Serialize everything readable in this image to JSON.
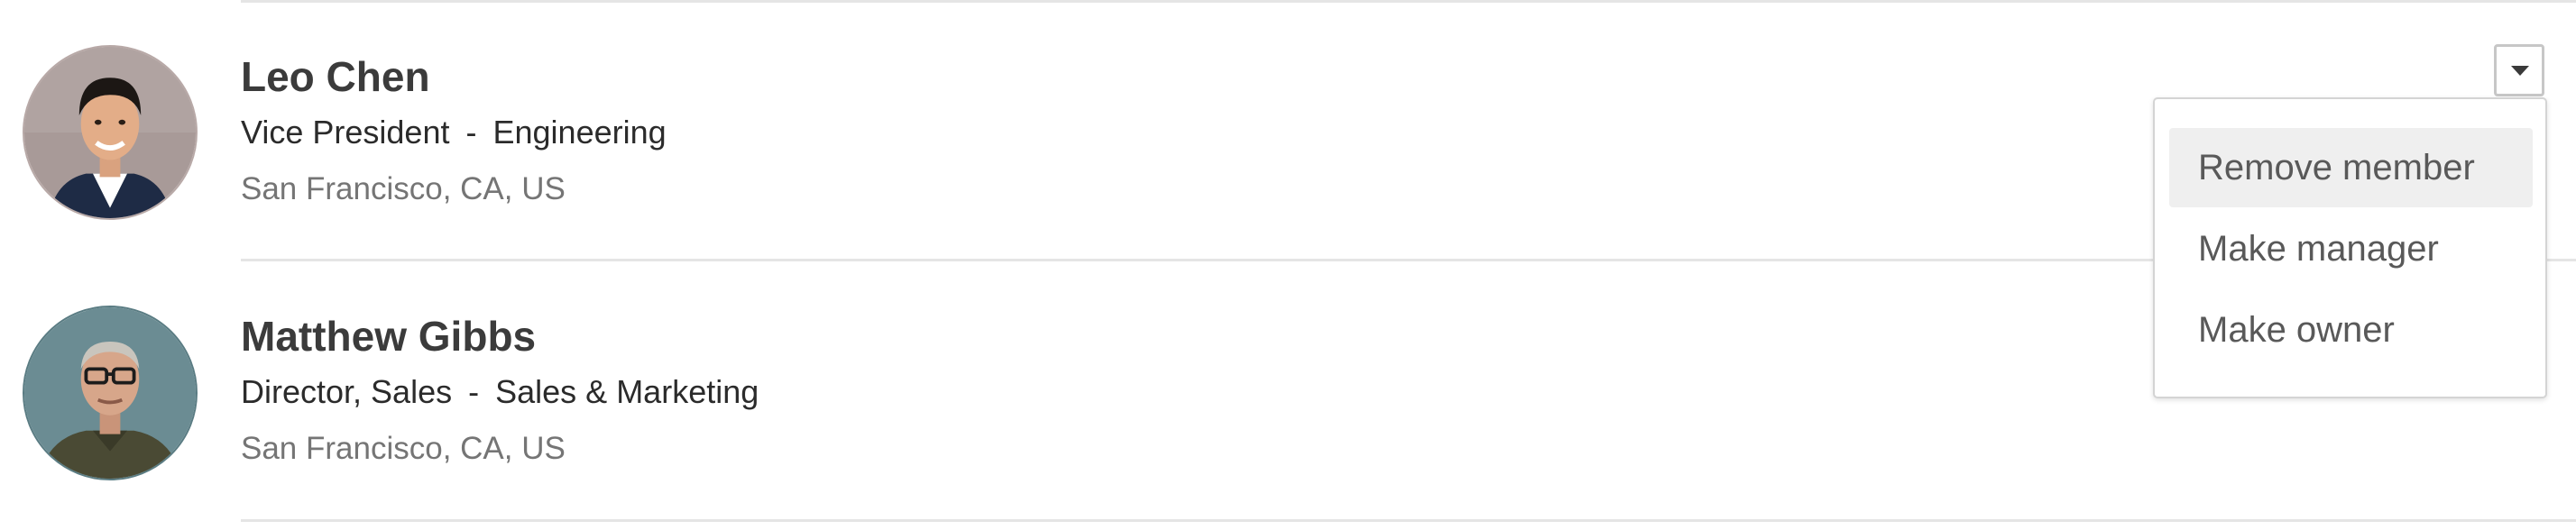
{
  "members": [
    {
      "name": "Leo Chen",
      "title": "Vice President",
      "separator": "-",
      "department": "Engineering",
      "location": "San Francisco, CA, US"
    },
    {
      "name": "Matthew Gibbs",
      "title": "Director, Sales",
      "separator": "-",
      "department": "Sales & Marketing",
      "location": "San Francisco, CA, US"
    }
  ],
  "dropdown": {
    "items": [
      "Remove member",
      "Make manager",
      "Make owner"
    ],
    "highlighted_item": "Remove member"
  },
  "colors": {
    "divider": "#e5e5e5",
    "hover_bg": "#efefef",
    "avatar1_bg": "#a89a98",
    "avatar2_bg": "#6b8c93"
  }
}
